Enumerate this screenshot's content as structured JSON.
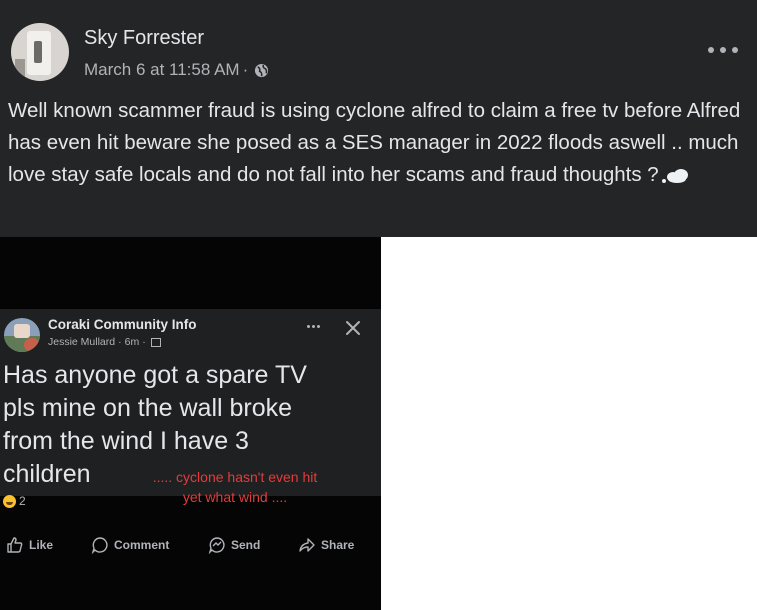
{
  "post": {
    "author": "Sky Forrester",
    "date": "March 6 at 11:58 AM",
    "dot": "·",
    "text": "Well known scammer fraud is using cyclone alfred to claim a free tv before Alfred has even hit beware she posed as a SES manager in 2022 floods aswell .. much love stay safe locals and do not fall into her scams and fraud thoughts ?"
  },
  "screenshot": {
    "group_name": "Coraki Community Info",
    "poster": "Jessie Mullard",
    "age": "6m",
    "dot": "·",
    "body_lines": [
      "Has anyone got a spare TV",
      "pls mine on the wall broke",
      "from the wind I have 3",
      "children"
    ],
    "annotation_line1": "..... cyclone hasn't even hit",
    "annotation_line2": "yet what wind ....",
    "annotation_color": "#e23c3c",
    "reaction_count": "2",
    "actions": {
      "like": "Like",
      "comment": "Comment",
      "send": "Send",
      "share": "Share"
    }
  },
  "colors": {
    "post_bg": "#242526",
    "card_bg": "#1f2021",
    "text": "#e4e6eb",
    "muted": "#b0b3b8"
  },
  "icons": [
    "profile-avatar",
    "globe-icon",
    "more-options-icon",
    "thought-balloon-icon",
    "group-avatar",
    "close-icon",
    "laughing-emoji-icon",
    "like-icon",
    "comment-icon",
    "send-icon",
    "share-icon"
  ]
}
